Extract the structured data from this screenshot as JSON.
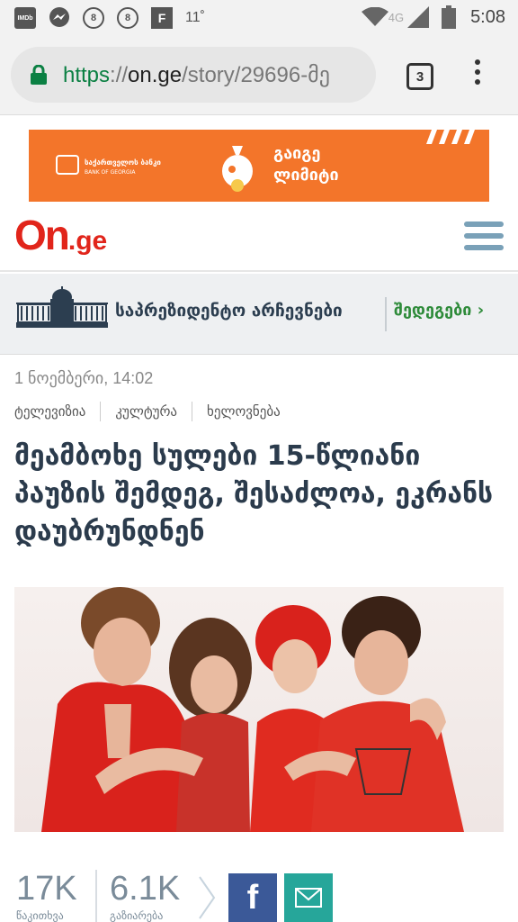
{
  "status_bar": {
    "imdb_label": "IMDb",
    "badge_1": "8",
    "badge_2": "8",
    "flipboard_label": "F",
    "temperature": "11˚",
    "network": "4G",
    "time": "5:08",
    "icons": [
      "imdb-icon",
      "messenger-icon",
      "notification-8-icon",
      "notification-8-icon",
      "flipboard-icon",
      "wifi-icon",
      "signal-icon",
      "battery-icon"
    ]
  },
  "browser": {
    "url_scheme": "https",
    "url_sep": "://",
    "url_host": "on.ge",
    "url_path": "/story/29696-მე",
    "tab_count": "3"
  },
  "banner_ad": {
    "bank_name": "საქართველოს ბანკი",
    "bank_sub": "BANK OF GEORGIA",
    "line1": "გაიგე",
    "line2": "ლიმიტი",
    "color": "#f3752a"
  },
  "site": {
    "logo_main": "On",
    "logo_suffix": ".ge",
    "brand_color": "#e1251b"
  },
  "presidential": {
    "title": "საპრეზიდენტო არჩევნები",
    "link": "შედეგები",
    "link_arrow": "›"
  },
  "article": {
    "date": "1 ნოემბერი, 14:02",
    "tags": [
      "ტელევიზია",
      "კულტურა",
      "ხელოვნება"
    ],
    "headline": "მეამბოხე სულები 15-წლიანი პაუზის შემდეგ, შესაძლოა, ეკრანს დაუბრუნდნენ"
  },
  "stats": {
    "reads_value": "17K",
    "reads_label": "წაკითხვა",
    "shares_value": "6.1K",
    "shares_label": "გაზიარება",
    "facebook_label": "f"
  }
}
